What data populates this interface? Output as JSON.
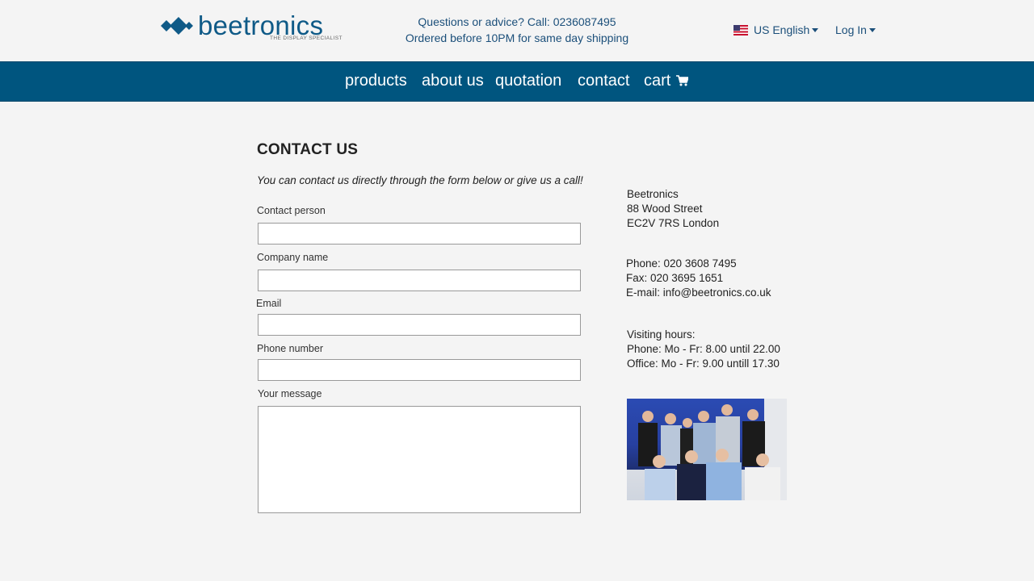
{
  "header": {
    "logo_text": "beetronics",
    "logo_tagline": "THE DISPLAY SPECIALIST",
    "phone_line": "Questions or advice? Call: 0236087495",
    "shipping_line": "Ordered before 10PM for same day shipping",
    "language_label": "US English",
    "login_label": "Log In"
  },
  "nav": {
    "items": [
      {
        "label": "products"
      },
      {
        "label": "about us"
      },
      {
        "label": "quotation"
      },
      {
        "label": "contact"
      },
      {
        "label": "cart"
      }
    ]
  },
  "main": {
    "title": "CONTACT US",
    "intro": "You can contact us directly through the form below or give us a call!",
    "form": {
      "contact_person_label": "Contact person",
      "company_name_label": "Company name",
      "email_label": "Email",
      "phone_label": "Phone number",
      "message_label": "Your message",
      "contact_person_value": "",
      "company_name_value": "",
      "email_value": "",
      "phone_value": "",
      "message_value": ""
    }
  },
  "sidebar": {
    "address": [
      "Beetronics",
      "88 Wood Street",
      "EC2V 7RS London"
    ],
    "contact": [
      "Phone: 020 3608 7495",
      "Fax: 020 3695 1651",
      "E-mail: info@beetronics.co.uk"
    ],
    "hours": [
      "Visiting hours:",
      "Phone: Mo - Fr: 8.00 until 22.00",
      "Office: Mo - Fr: 9.00 untill 17.30"
    ]
  },
  "colors": {
    "brand_blue": "#0f5a87",
    "nav_background": "#00557f",
    "page_background": "#f4f4f4"
  },
  "icons": {
    "logo": "diamond-logo-icon",
    "flag": "us-flag-icon",
    "dropdown": "caret-down-icon",
    "cart": "shopping-cart-icon"
  }
}
